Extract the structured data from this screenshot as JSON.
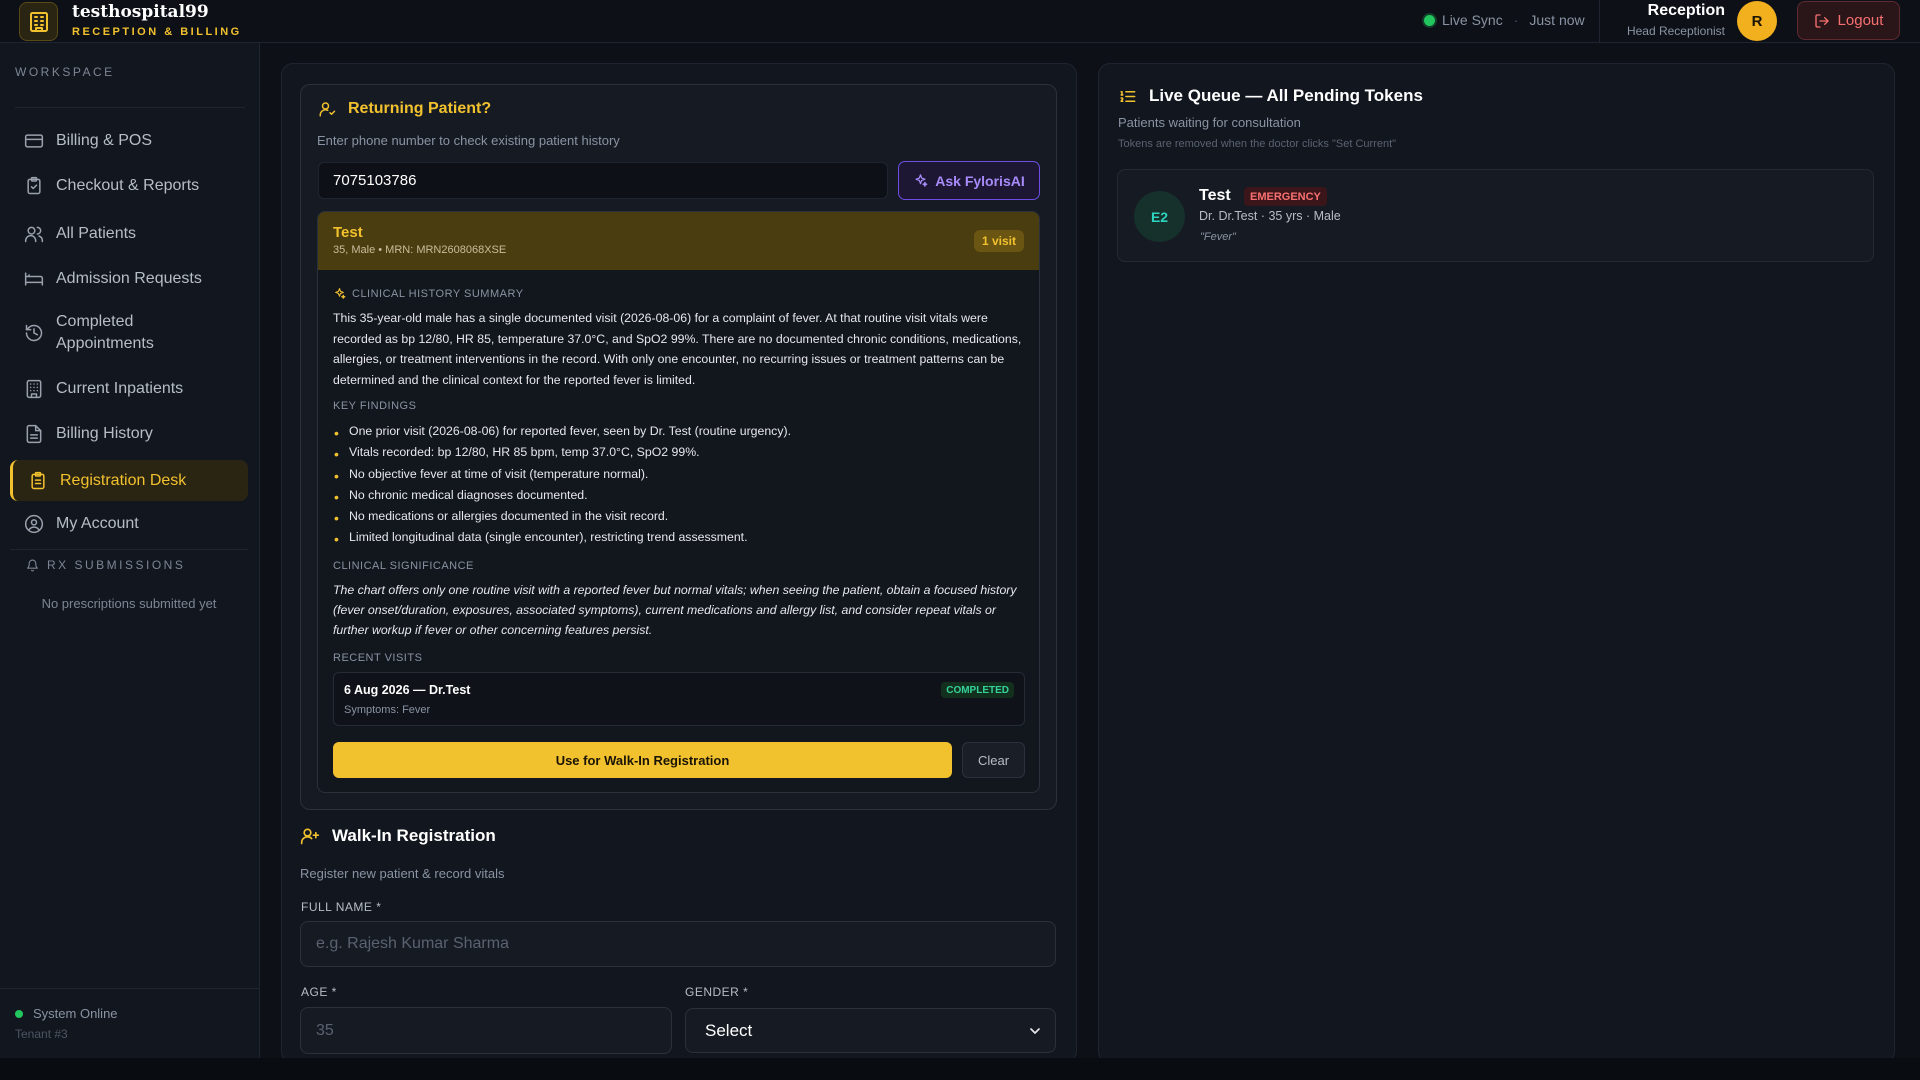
{
  "header": {
    "brand_name": "testhospital99",
    "brand_sub": "RECEPTION & BILLING",
    "live_sync": "Live Sync",
    "sync_time": "Just now",
    "user_name": "Reception",
    "user_role": "Head Receptionist",
    "avatar_initial": "R",
    "logout_label": "Logout"
  },
  "sidebar": {
    "workspace_label": "WORKSPACE",
    "items": [
      {
        "label": "Billing & POS",
        "icon": "card-icon"
      },
      {
        "label": "Checkout & Reports",
        "icon": "clipboard-check-icon"
      },
      {
        "label": "All Patients",
        "icon": "users-icon"
      },
      {
        "label": "Admission Requests",
        "icon": "bed-icon"
      },
      {
        "label": "Completed Appointments",
        "icon": "history-icon"
      },
      {
        "label": "Current Inpatients",
        "icon": "building-icon"
      },
      {
        "label": "Billing History",
        "icon": "file-text-icon"
      },
      {
        "label": "Registration Desk",
        "icon": "clipboard-list-icon",
        "active": true
      },
      {
        "label": "My Account",
        "icon": "user-circle-icon"
      }
    ],
    "rx_label": "RX SUBMISSIONS",
    "rx_empty": "No prescriptions submitted yet",
    "system_status": "System Online",
    "tenant": "Tenant #3"
  },
  "returning": {
    "title": "Returning Patient?",
    "subtitle": "Enter phone number to check existing patient history",
    "phone_value": "7075103786",
    "ask_label": "Ask FylorisAI",
    "patient": {
      "name": "Test",
      "meta": "35, Male • MRN: MRN2608068XSE",
      "visits": "1 visit"
    },
    "summary_label": "CLINICAL HISTORY SUMMARY",
    "summary": "This 35-year-old male has a single documented visit (2026-08-06) for a complaint of fever. At that routine visit vitals were recorded as bp 12/80, HR 85, temperature 37.0°C, and SpO2 99%. There are no documented chronic conditions, medications, allergies, or treatment interventions in the record. With only one encounter, no recurring issues or treatment patterns can be determined and the clinical context for the reported fever is limited.",
    "findings_label": "KEY FINDINGS",
    "findings": [
      "One prior visit (2026-08-06) for reported fever, seen by Dr. Test (routine urgency).",
      "Vitals recorded: bp 12/80, HR 85 bpm, temp 37.0°C, SpO2 99%.",
      "No objective fever at time of visit (temperature normal).",
      "No chronic medical diagnoses documented.",
      "No medications or allergies documented in the visit record.",
      "Limited longitudinal data (single encounter), restricting trend assessment."
    ],
    "significance_label": "CLINICAL SIGNIFICANCE",
    "significance": "The chart offers only one routine visit with a reported fever but normal vitals; when seeing the patient, obtain a focused history (fever onset/duration, exposures, associated symptoms), current medications and allergy list, and consider repeat vitals or further workup if fever or other concerning features persist.",
    "recent_label": "RECENT VISITS",
    "recent_visit": {
      "title": "6 Aug 2026 — Dr.Test",
      "symptoms": "Symptoms: Fever",
      "status": "COMPLETED"
    },
    "use_label": "Use for Walk-In Registration",
    "clear_label": "Clear"
  },
  "walkin": {
    "title": "Walk-In Registration",
    "subtitle": "Register new patient & record vitals",
    "fullname_label": "FULL NAME *",
    "fullname_placeholder": "e.g. Rajesh Kumar Sharma",
    "age_label": "AGE *",
    "age_placeholder": "35",
    "gender_label": "GENDER *",
    "gender_value": "Select"
  },
  "queue": {
    "title": "Live Queue — All Pending Tokens",
    "subtitle": "Patients waiting for consultation",
    "note": "Tokens are removed when the doctor clicks \"Set Current\"",
    "tokens": [
      {
        "token": "E2",
        "name": "Test",
        "badge": "EMERGENCY",
        "meta": "Dr. Dr.Test · 35 yrs · Male",
        "symptom": "\"Fever\""
      }
    ]
  },
  "colors": {
    "accent": "#f2c12e",
    "background": "#0d1117",
    "panel": "#12171f",
    "success": "#22c55e",
    "danger": "#f87171",
    "ai": "#a78bfa"
  }
}
